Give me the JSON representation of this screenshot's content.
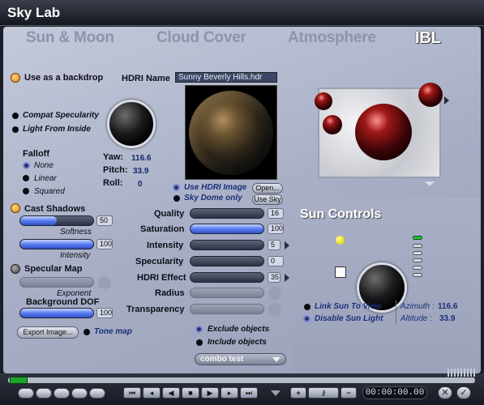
{
  "window": {
    "title": "Sky Lab"
  },
  "tabs": [
    {
      "label": "Sun & Moon"
    },
    {
      "label": "Cloud Cover"
    },
    {
      "label": "Atmosphere"
    },
    {
      "label": "IBL"
    }
  ],
  "backdrop": {
    "label": "Use as a backdrop"
  },
  "options": {
    "compat_specularity": "Compat Specularity",
    "light_from_inside": "Light From Inside"
  },
  "falloff": {
    "label": "Falloff",
    "options": [
      "None",
      "Linear",
      "Squared"
    ],
    "selected": "None"
  },
  "hdri": {
    "name_label": "HDRI Name",
    "name_value": "Sunny Beverly Hills.hdr",
    "yaw_label": "Yaw:",
    "yaw": "116.6",
    "pitch_label": "Pitch:",
    "pitch": "33.9",
    "roll_label": "Roll:",
    "roll": "0",
    "use_hdri_image": "Use HDRI Image",
    "open_button": "Open...",
    "sky_dome_only": "Sky Dome only",
    "use_sky_button": "Use Sky"
  },
  "cast_shadows": {
    "label": "Cast Shadows",
    "softness_label": "Softness",
    "softness": "50",
    "softness_level": 0.5,
    "intensity_label": "Intensity",
    "intensity": "100",
    "intensity_level": 1.0
  },
  "specular_map": {
    "label": "Specular Map",
    "exponent_label": "Exponent"
  },
  "background_dof": {
    "label": "Background DOF",
    "value": "100",
    "level": 1.0
  },
  "export_button": "Export Image...",
  "tone_map": "Tone map",
  "params": [
    {
      "label": "Quality",
      "value": "16",
      "level": 0.0
    },
    {
      "label": "Saturation",
      "value": "100",
      "level": 1.0
    },
    {
      "label": "Intensity",
      "value": "5",
      "level": 0.0
    },
    {
      "label": "Specularity",
      "value": "0",
      "level": 0.0
    },
    {
      "label": "HDRI Effect",
      "value": "35",
      "level": 0.0
    },
    {
      "label": "Radius",
      "value": "",
      "level": 0.0
    },
    {
      "label": "Transparency",
      "value": "",
      "level": 0.0
    }
  ],
  "objects": {
    "exclude": "Exclude objects",
    "include": "Include objects",
    "combo": "combo test"
  },
  "sun_controls": {
    "title": "Sun Controls",
    "link_sun": "Link Sun To View",
    "disable_sun": "Disable Sun Light",
    "azimuth_label": "Azimuth :",
    "azimuth": "116.6",
    "altitude_label": "Altitude :",
    "altitude": "33.9"
  },
  "timeline": {
    "time": "00:00:00.00",
    "frame_marker": "+"
  }
}
